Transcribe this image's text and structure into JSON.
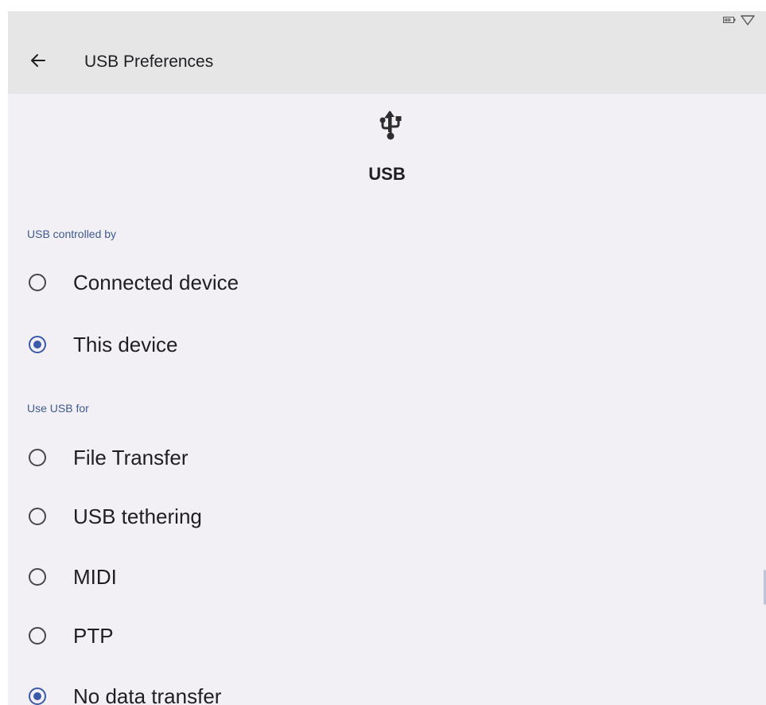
{
  "status_bar": {
    "icons": [
      "battery-icon",
      "wifi-icon"
    ]
  },
  "app_bar": {
    "back_icon": "arrow-left",
    "title": "USB Preferences"
  },
  "hero": {
    "icon": "usb-icon",
    "title": "USB"
  },
  "sections": [
    {
      "header": "USB controlled by",
      "options": [
        {
          "label": "Connected device",
          "checked": false
        },
        {
          "label": "This device",
          "checked": true
        }
      ]
    },
    {
      "header": "Use USB for",
      "options": [
        {
          "label": "File Transfer",
          "checked": false
        },
        {
          "label": "USB tethering",
          "checked": false
        },
        {
          "label": "MIDI",
          "checked": false
        },
        {
          "label": "PTP",
          "checked": false
        },
        {
          "label": "No data transfer",
          "checked": true
        }
      ]
    }
  ],
  "colors": {
    "accent": "#3b5ba9",
    "section_header": "#3f5a8e",
    "background": "#f2f0f4",
    "app_bar": "#e6e6e6"
  }
}
